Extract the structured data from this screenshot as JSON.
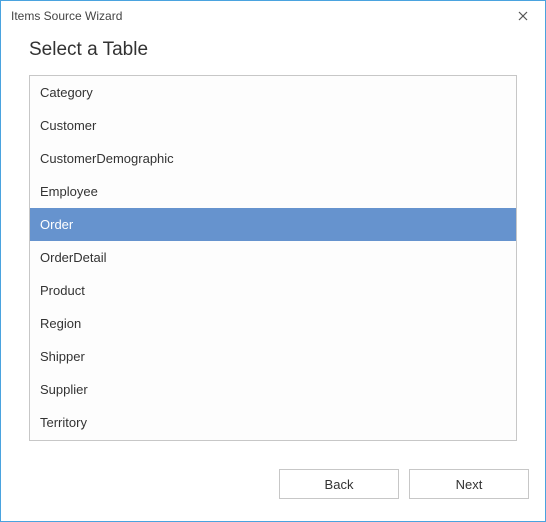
{
  "window": {
    "title": "Items Source Wizard"
  },
  "heading": "Select a Table",
  "tables": [
    {
      "label": "Category",
      "selected": false
    },
    {
      "label": "Customer",
      "selected": false
    },
    {
      "label": "CustomerDemographic",
      "selected": false
    },
    {
      "label": "Employee",
      "selected": false
    },
    {
      "label": "Order",
      "selected": true
    },
    {
      "label": "OrderDetail",
      "selected": false
    },
    {
      "label": "Product",
      "selected": false
    },
    {
      "label": "Region",
      "selected": false
    },
    {
      "label": "Shipper",
      "selected": false
    },
    {
      "label": "Supplier",
      "selected": false
    },
    {
      "label": "Territory",
      "selected": false
    }
  ],
  "buttons": {
    "back": "Back",
    "next": "Next"
  }
}
